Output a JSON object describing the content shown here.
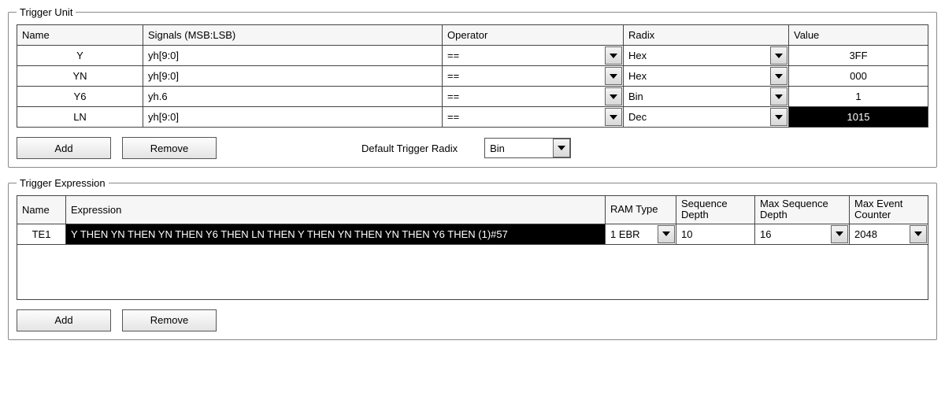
{
  "triggerUnit": {
    "legend": "Trigger Unit",
    "headers": {
      "name": "Name",
      "signals": "Signals (MSB:LSB)",
      "operator": "Operator",
      "radix": "Radix",
      "value": "Value"
    },
    "rows": [
      {
        "name": "Y",
        "signals": "yh[9:0]",
        "operator": "==",
        "radix": "Hex",
        "value": "3FF",
        "valueDark": false
      },
      {
        "name": "YN",
        "signals": "yh[9:0]",
        "operator": "==",
        "radix": "Hex",
        "value": "000",
        "valueDark": false
      },
      {
        "name": "Y6",
        "signals": "yh.6",
        "operator": "==",
        "radix": "Bin",
        "value": "1",
        "valueDark": false
      },
      {
        "name": "LN",
        "signals": "yh[9:0]",
        "operator": "==",
        "radix": "Dec",
        "value": "1015",
        "valueDark": true
      }
    ],
    "buttons": {
      "add": "Add",
      "remove": "Remove"
    },
    "defaultRadixLabel": "Default Trigger Radix",
    "defaultRadixValue": "Bin"
  },
  "triggerExpression": {
    "legend": "Trigger Expression",
    "headers": {
      "name": "Name",
      "expression": "Expression",
      "ramType": "RAM Type",
      "seqDepth": "Sequence Depth",
      "maxSeqDepth": "Max Sequence Depth",
      "maxEvent": "Max Event Counter"
    },
    "row": {
      "name": "TE1",
      "expression": "Y THEN YN THEN YN THEN Y6 THEN LN THEN Y THEN YN THEN YN THEN Y6 THEN (1)#57",
      "ramType": "1 EBR",
      "seqDepth": "10",
      "maxSeqDepth": "16",
      "maxEvent": "2048"
    },
    "buttons": {
      "add": "Add",
      "remove": "Remove"
    }
  }
}
